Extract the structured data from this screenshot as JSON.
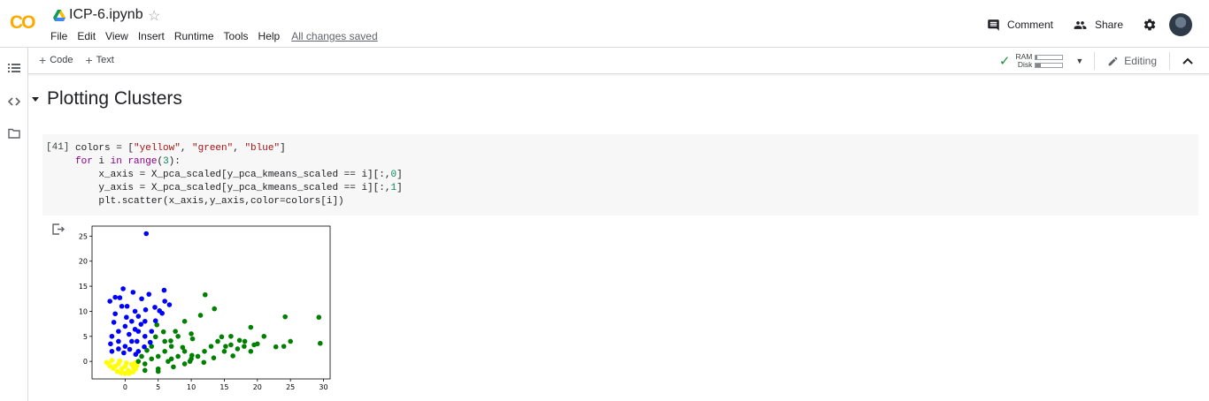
{
  "header": {
    "logo_text": "CO",
    "title": "ICP-6.ipynb",
    "menu": [
      "File",
      "Edit",
      "View",
      "Insert",
      "Runtime",
      "Tools",
      "Help"
    ],
    "save_status": "All changes saved",
    "comment_label": "Comment",
    "share_label": "Share"
  },
  "toolbar": {
    "add_code": "Code",
    "add_text": "Text",
    "ram_label": "RAM",
    "disk_label": "Disk",
    "ram_fraction": 0.05,
    "disk_fraction": 0.2,
    "editing_label": "Editing"
  },
  "notebook": {
    "section_title": "Plotting Clusters",
    "cell": {
      "execution_count": "[41]",
      "code_lines": [
        "colors = [\"yellow\", \"green\", \"blue\"]",
        "for i in range(3):",
        "    x_axis = X_pca_scaled[y_pca_kmeans_scaled == i][:,0]",
        "    y_axis = X_pca_scaled[y_pca_kmeans_scaled == i][:,1]",
        "    plt.scatter(x_axis,y_axis,color=colors[i])"
      ]
    }
  },
  "chart_data": {
    "type": "scatter",
    "xlim": [
      -5,
      31
    ],
    "ylim": [
      -3.5,
      27
    ],
    "x_ticks": [
      "0",
      "5",
      "10",
      "15",
      "20",
      "25",
      "30"
    ],
    "y_ticks": [
      "0",
      "5",
      "10",
      "15",
      "20",
      "25"
    ],
    "grid": false,
    "series": [
      {
        "color": "#ffff00",
        "points": [
          [
            -2.8,
            -0.2
          ],
          [
            -2.3,
            -0.9
          ],
          [
            -1.8,
            -1.4
          ],
          [
            -1.2,
            -2
          ],
          [
            -0.6,
            -2.3
          ],
          [
            0,
            -2.4
          ],
          [
            0.6,
            -2.4
          ],
          [
            1.2,
            -2.1
          ],
          [
            1.6,
            -1.5
          ],
          [
            1.8,
            -0.8
          ],
          [
            1.6,
            -0.2
          ],
          [
            -2,
            0.2
          ],
          [
            -1,
            -0.5
          ],
          [
            0,
            -1
          ],
          [
            1,
            -0.6
          ],
          [
            -1.5,
            -1
          ],
          [
            0.5,
            -1.8
          ],
          [
            -0.5,
            -1.5
          ],
          [
            1.3,
            -1.2
          ],
          [
            -2.5,
            -0.5
          ],
          [
            0.2,
            -0.3
          ],
          [
            -0.8,
            0.1
          ]
        ]
      },
      {
        "color": "#008000",
        "points": [
          [
            2,
            0
          ],
          [
            3,
            -0.5
          ],
          [
            4,
            0.5
          ],
          [
            5,
            1
          ],
          [
            6,
            2
          ],
          [
            4,
            3
          ],
          [
            6,
            4
          ],
          [
            3,
            -1.8
          ],
          [
            5,
            -1.5
          ],
          [
            2.5,
            1
          ],
          [
            7,
            0.5
          ],
          [
            8,
            1
          ],
          [
            9,
            -0.5
          ],
          [
            10,
            0.5
          ],
          [
            11,
            1
          ],
          [
            5,
            -2
          ],
          [
            7,
            3
          ],
          [
            8,
            5
          ],
          [
            9,
            2
          ],
          [
            12,
            2
          ],
          [
            13,
            3
          ],
          [
            14,
            4
          ],
          [
            15,
            2
          ],
          [
            16,
            5
          ],
          [
            17,
            2.5
          ],
          [
            18,
            3
          ],
          [
            19,
            2
          ],
          [
            20,
            3.5
          ],
          [
            21,
            5
          ],
          [
            25,
            4
          ],
          [
            24,
            3
          ],
          [
            29.3,
            8.8
          ],
          [
            29.5,
            3.6
          ],
          [
            24.2,
            8.9
          ],
          [
            22.8,
            2.9
          ],
          [
            12.1,
            13.3
          ],
          [
            13.5,
            10.5
          ],
          [
            16,
            3.3
          ],
          [
            19,
            6.8
          ],
          [
            19.5,
            3.3
          ],
          [
            15.2,
            3
          ],
          [
            17.3,
            4.2
          ],
          [
            14.6,
            4.9
          ],
          [
            10,
            5.5
          ],
          [
            11.4,
            9.2
          ],
          [
            9,
            8
          ],
          [
            10.2,
            4.5
          ],
          [
            8.7,
            2.8
          ],
          [
            6.9,
            4.1
          ],
          [
            4.8,
            7.3
          ],
          [
            5.8,
            5.9
          ],
          [
            7.6,
            6
          ],
          [
            6.5,
            0
          ],
          [
            10.1,
            1.2
          ],
          [
            11.9,
            -0.2
          ],
          [
            13.4,
            0.7
          ],
          [
            16.3,
            1.1
          ],
          [
            18.1,
            4
          ],
          [
            9.8,
            0
          ],
          [
            7.3,
            -1.1
          ],
          [
            3.3,
            2.2
          ],
          [
            4.6,
            4.9
          ]
        ]
      },
      {
        "color": "#0000ff",
        "points": [
          [
            3.2,
            25.5
          ],
          [
            -2,
            2
          ],
          [
            -1,
            2.5
          ],
          [
            0,
            3
          ],
          [
            1,
            4
          ],
          [
            2,
            2
          ],
          [
            -2,
            5
          ],
          [
            -1,
            6
          ],
          [
            0,
            7
          ],
          [
            1,
            8
          ],
          [
            2,
            6
          ],
          [
            3,
            5
          ],
          [
            -1.5,
            9.5
          ],
          [
            -0.5,
            11
          ],
          [
            0.3,
            11
          ],
          [
            1.5,
            10
          ],
          [
            -2.3,
            12
          ],
          [
            -1.5,
            12.8
          ],
          [
            -0.3,
            14.5
          ],
          [
            1.2,
            13.8
          ],
          [
            2.5,
            12.5
          ],
          [
            3.6,
            13.4
          ],
          [
            5.9,
            14.2
          ],
          [
            6,
            12
          ],
          [
            4.5,
            10.8
          ],
          [
            5.2,
            10.1
          ],
          [
            2,
            9
          ],
          [
            3,
            8
          ],
          [
            4,
            6
          ],
          [
            -1.7,
            7.8
          ],
          [
            0.6,
            5.4
          ],
          [
            1.8,
            4
          ],
          [
            2.9,
            2.9
          ],
          [
            3.8,
            3.8
          ],
          [
            -2.2,
            3.5
          ],
          [
            -0.2,
            1.7
          ],
          [
            0.7,
            2.4
          ],
          [
            1.6,
            1.4
          ],
          [
            -1,
            4
          ],
          [
            0.2,
            8.8
          ],
          [
            1.5,
            6.4
          ],
          [
            2.4,
            7.4
          ],
          [
            3.1,
            10.3
          ],
          [
            4.6,
            8.1
          ],
          [
            -0.8,
            12.7
          ],
          [
            6.7,
            11.3
          ],
          [
            5.6,
            9.6
          ]
        ]
      }
    ]
  }
}
